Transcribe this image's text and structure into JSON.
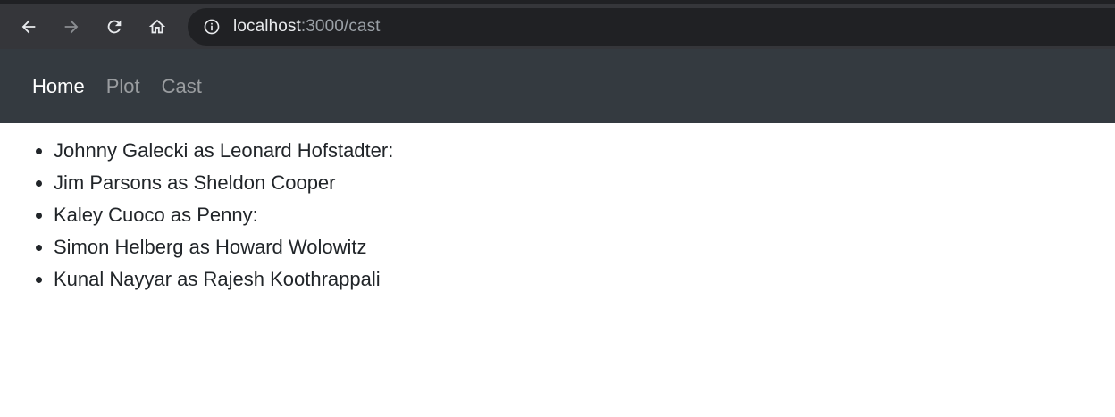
{
  "browser": {
    "url_host": "localhost",
    "url_rest": ":3000/cast",
    "icons": [
      "back-arrow-icon",
      "forward-arrow-icon",
      "reload-icon",
      "home-icon",
      "info-icon"
    ]
  },
  "navbar": {
    "links": [
      {
        "label": "Home",
        "active": true
      },
      {
        "label": "Plot",
        "active": false
      },
      {
        "label": "Cast",
        "active": false
      }
    ]
  },
  "cast": [
    "Johnny Galecki as Leonard Hofstadter:",
    "Jim Parsons as Sheldon Cooper",
    "Kaley Cuoco as Penny:",
    "Simon Helberg as Howard Wolowitz",
    "Kunal Nayyar as Rajesh Koothrappali"
  ]
}
